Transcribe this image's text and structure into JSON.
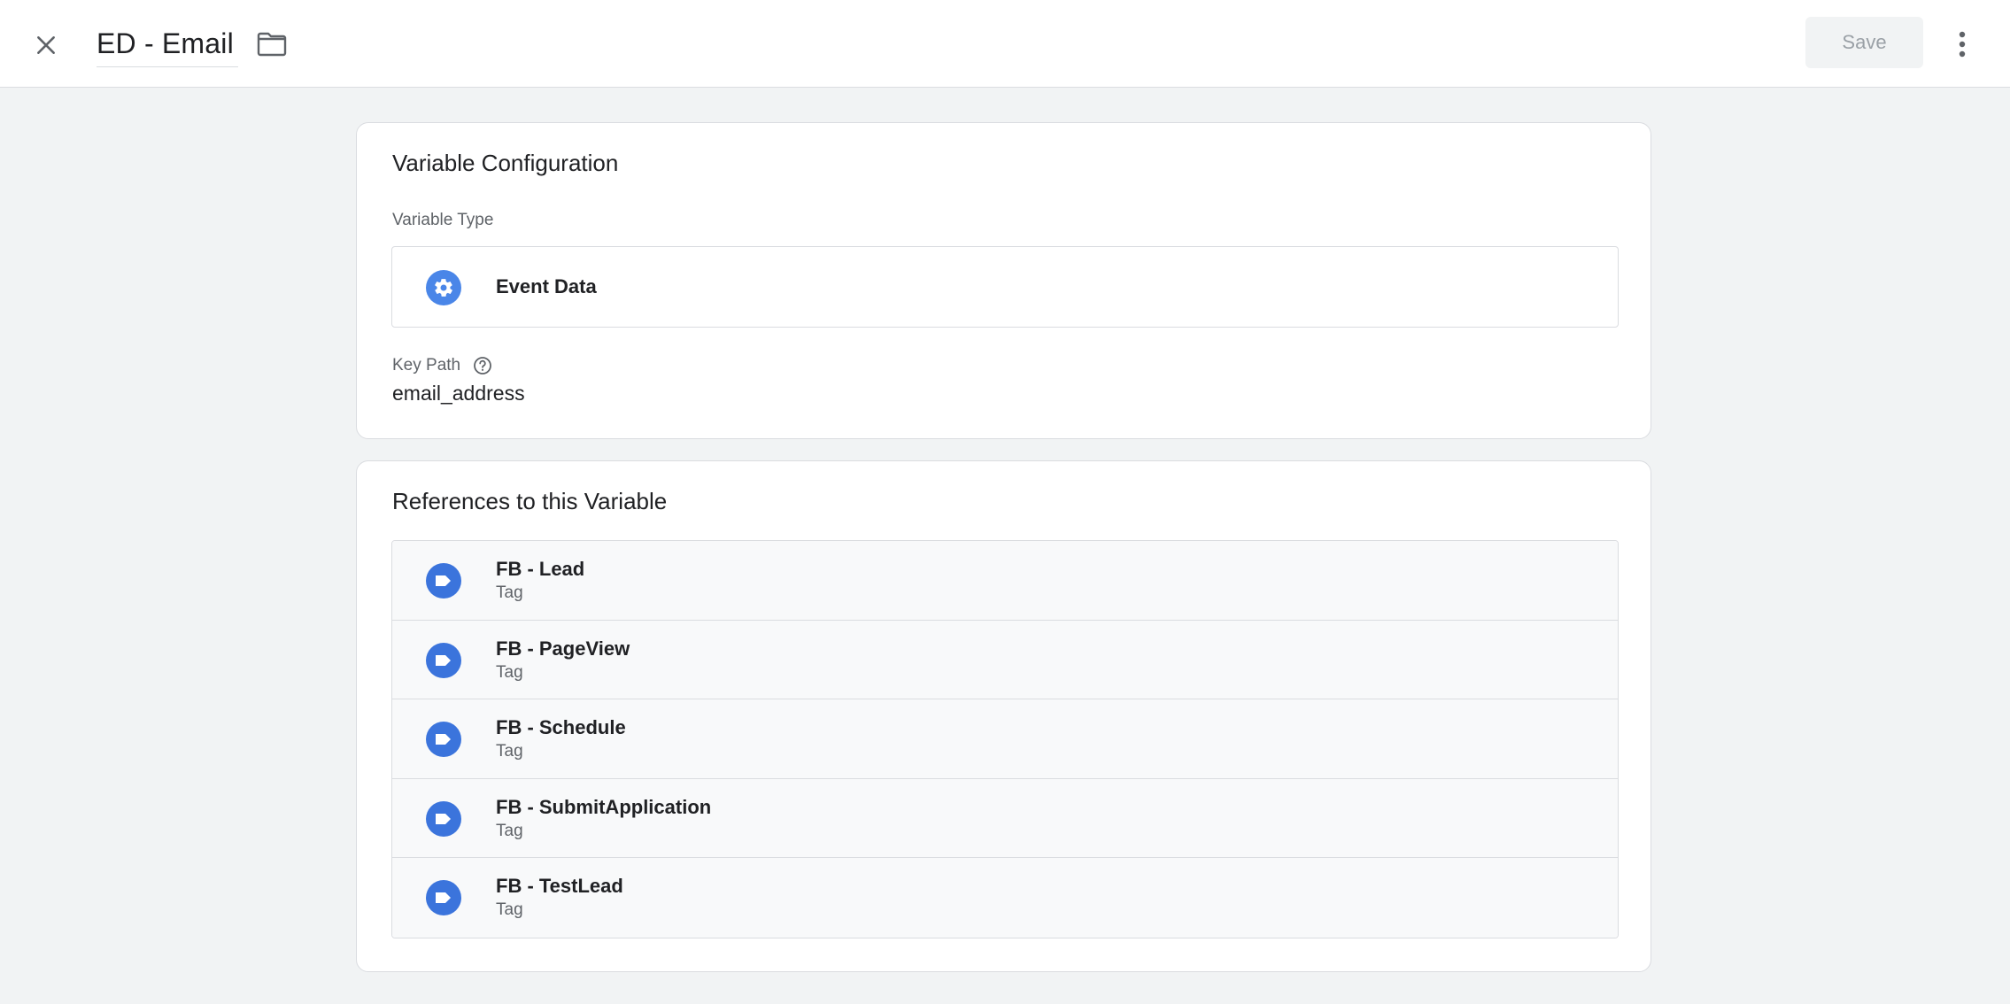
{
  "header": {
    "title": "ED - Email",
    "save_label": "Save",
    "icons": {
      "close": "close-icon",
      "folder": "folder-icon",
      "more": "more-vert-icon"
    }
  },
  "config": {
    "heading": "Variable Configuration",
    "variable_type_label": "Variable Type",
    "variable_type_value": "Event Data",
    "variable_type_icon": "gear-icon",
    "key_path_label": "Key Path",
    "key_path_value": "email_address"
  },
  "references": {
    "heading": "References to this Variable",
    "items": [
      {
        "name": "FB - Lead",
        "type": "Tag"
      },
      {
        "name": "FB - PageView",
        "type": "Tag"
      },
      {
        "name": "FB - Schedule",
        "type": "Tag"
      },
      {
        "name": "FB - SubmitApplication",
        "type": "Tag"
      },
      {
        "name": "FB - TestLead",
        "type": "Tag"
      }
    ]
  },
  "colors": {
    "accent_blue": "#3b74dc",
    "background": "#f1f3f4",
    "card": "#ffffff"
  }
}
